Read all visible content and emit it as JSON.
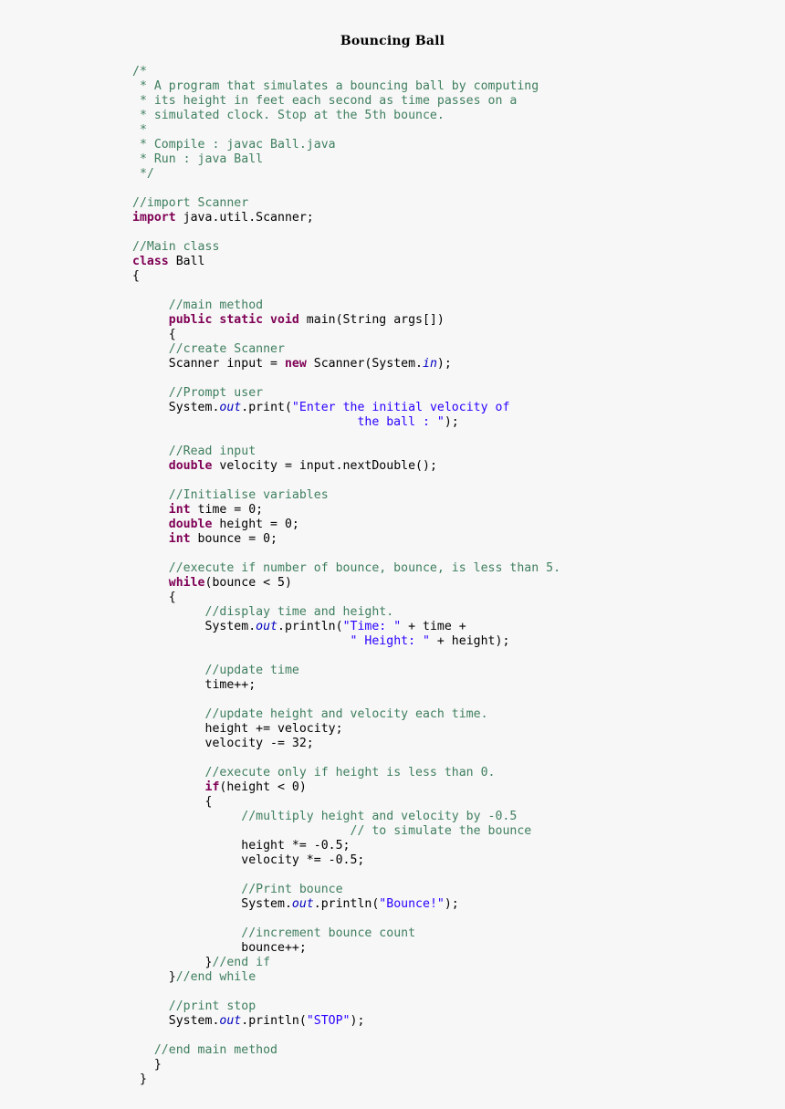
{
  "document": {
    "title": "Bouncing Ball",
    "language": "java",
    "colors": {
      "background": "#f7f7f7",
      "plain": "#000000",
      "comment": "#3f7f5f",
      "keyword": "#7f0055",
      "string": "#2a00ff",
      "static_field": "#0000c0"
    }
  },
  "code": {
    "lines": [
      [
        {
          "t": "/*",
          "c": "cmt"
        }
      ],
      [
        {
          "t": " * A program that simulates a bouncing ball by computing",
          "c": "cmt"
        }
      ],
      [
        {
          "t": " * its height in feet each second as time passes on a",
          "c": "cmt"
        }
      ],
      [
        {
          "t": " * simulated clock. Stop at the 5th bounce.",
          "c": "cmt"
        }
      ],
      [
        {
          "t": " *",
          "c": "cmt"
        }
      ],
      [
        {
          "t": " * Compile : javac Ball.java",
          "c": "cmt"
        }
      ],
      [
        {
          "t": " * Run : java Ball",
          "c": "cmt"
        }
      ],
      [
        {
          "t": " */",
          "c": "cmt"
        }
      ],
      [],
      [
        {
          "t": "//import Scanner",
          "c": "cmt"
        }
      ],
      [
        {
          "t": "import",
          "c": "kw"
        },
        {
          "t": " java.util.Scanner;",
          "c": "pln"
        }
      ],
      [],
      [
        {
          "t": "//Main class",
          "c": "cmt"
        }
      ],
      [
        {
          "t": "class",
          "c": "kw"
        },
        {
          "t": " Ball",
          "c": "pln"
        }
      ],
      [
        {
          "t": "{",
          "c": "pln"
        }
      ],
      [],
      [
        {
          "t": "     ",
          "c": "pln"
        },
        {
          "t": "//main method",
          "c": "cmt"
        }
      ],
      [
        {
          "t": "     ",
          "c": "pln"
        },
        {
          "t": "public static void",
          "c": "kw"
        },
        {
          "t": " main(String args[])",
          "c": "pln"
        }
      ],
      [
        {
          "t": "     {",
          "c": "pln"
        }
      ],
      [
        {
          "t": "     ",
          "c": "pln"
        },
        {
          "t": "//create Scanner",
          "c": "cmt"
        }
      ],
      [
        {
          "t": "     Scanner input = ",
          "c": "pln"
        },
        {
          "t": "new",
          "c": "kw"
        },
        {
          "t": " Scanner(System.",
          "c": "pln"
        },
        {
          "t": "in",
          "c": "fld"
        },
        {
          "t": ");",
          "c": "pln"
        }
      ],
      [],
      [
        {
          "t": "     ",
          "c": "pln"
        },
        {
          "t": "//Prompt user",
          "c": "cmt"
        }
      ],
      [
        {
          "t": "     System.",
          "c": "pln"
        },
        {
          "t": "out",
          "c": "fld"
        },
        {
          "t": ".print(",
          "c": "pln"
        },
        {
          "t": "\"Enter the initial velocity of",
          "c": "str"
        }
      ],
      [
        {
          "t": "                               ",
          "c": "pln"
        },
        {
          "t": "the ball : \"",
          "c": "str"
        },
        {
          "t": ");",
          "c": "pln"
        }
      ],
      [],
      [
        {
          "t": "     ",
          "c": "pln"
        },
        {
          "t": "//Read input",
          "c": "cmt"
        }
      ],
      [
        {
          "t": "     ",
          "c": "pln"
        },
        {
          "t": "double",
          "c": "kw"
        },
        {
          "t": " velocity = input.nextDouble();",
          "c": "pln"
        }
      ],
      [],
      [
        {
          "t": "     ",
          "c": "pln"
        },
        {
          "t": "//Initialise variables",
          "c": "cmt"
        }
      ],
      [
        {
          "t": "     ",
          "c": "pln"
        },
        {
          "t": "int",
          "c": "kw"
        },
        {
          "t": " time = 0;",
          "c": "pln"
        }
      ],
      [
        {
          "t": "     ",
          "c": "pln"
        },
        {
          "t": "double",
          "c": "kw"
        },
        {
          "t": " height = 0;",
          "c": "pln"
        }
      ],
      [
        {
          "t": "     ",
          "c": "pln"
        },
        {
          "t": "int",
          "c": "kw"
        },
        {
          "t": " bounce = 0;",
          "c": "pln"
        }
      ],
      [],
      [
        {
          "t": "     ",
          "c": "pln"
        },
        {
          "t": "//execute if number of bounce, bounce, is less than 5.",
          "c": "cmt"
        }
      ],
      [
        {
          "t": "     ",
          "c": "pln"
        },
        {
          "t": "while",
          "c": "kw"
        },
        {
          "t": "(bounce < 5)",
          "c": "pln"
        }
      ],
      [
        {
          "t": "     {",
          "c": "pln"
        }
      ],
      [
        {
          "t": "          ",
          "c": "pln"
        },
        {
          "t": "//display time and height.",
          "c": "cmt"
        }
      ],
      [
        {
          "t": "          System.",
          "c": "pln"
        },
        {
          "t": "out",
          "c": "fld"
        },
        {
          "t": ".println(",
          "c": "pln"
        },
        {
          "t": "\"Time: \"",
          "c": "str"
        },
        {
          "t": " + time +",
          "c": "pln"
        }
      ],
      [
        {
          "t": "                              ",
          "c": "pln"
        },
        {
          "t": "\" Height: \"",
          "c": "str"
        },
        {
          "t": " + height);",
          "c": "pln"
        }
      ],
      [],
      [
        {
          "t": "          ",
          "c": "pln"
        },
        {
          "t": "//update time",
          "c": "cmt"
        }
      ],
      [
        {
          "t": "          time++;",
          "c": "pln"
        }
      ],
      [],
      [
        {
          "t": "          ",
          "c": "pln"
        },
        {
          "t": "//update height and velocity each time.",
          "c": "cmt"
        }
      ],
      [
        {
          "t": "          height += velocity;",
          "c": "pln"
        }
      ],
      [
        {
          "t": "          velocity -= 32;",
          "c": "pln"
        }
      ],
      [],
      [
        {
          "t": "          ",
          "c": "pln"
        },
        {
          "t": "//execute only if height is less than 0.",
          "c": "cmt"
        }
      ],
      [
        {
          "t": "          ",
          "c": "pln"
        },
        {
          "t": "if",
          "c": "kw"
        },
        {
          "t": "(height < 0)",
          "c": "pln"
        }
      ],
      [
        {
          "t": "          {",
          "c": "pln"
        }
      ],
      [
        {
          "t": "               ",
          "c": "pln"
        },
        {
          "t": "//multiply height and velocity by -0.5",
          "c": "cmt"
        }
      ],
      [
        {
          "t": "                              ",
          "c": "pln"
        },
        {
          "t": "// to simulate the bounce",
          "c": "cmt"
        }
      ],
      [
        {
          "t": "               height *= -0.5;",
          "c": "pln"
        }
      ],
      [
        {
          "t": "               velocity *= -0.5;",
          "c": "pln"
        }
      ],
      [],
      [
        {
          "t": "               ",
          "c": "pln"
        },
        {
          "t": "//Print bounce",
          "c": "cmt"
        }
      ],
      [
        {
          "t": "               System.",
          "c": "pln"
        },
        {
          "t": "out",
          "c": "fld"
        },
        {
          "t": ".println(",
          "c": "pln"
        },
        {
          "t": "\"Bounce!\"",
          "c": "str"
        },
        {
          "t": ");",
          "c": "pln"
        }
      ],
      [],
      [
        {
          "t": "               ",
          "c": "pln"
        },
        {
          "t": "//increment bounce count",
          "c": "cmt"
        }
      ],
      [
        {
          "t": "               bounce++;",
          "c": "pln"
        }
      ],
      [
        {
          "t": "          }",
          "c": "pln"
        },
        {
          "t": "//end if",
          "c": "cmt"
        }
      ],
      [
        {
          "t": "     }",
          "c": "pln"
        },
        {
          "t": "//end while",
          "c": "cmt"
        }
      ],
      [],
      [
        {
          "t": "     ",
          "c": "pln"
        },
        {
          "t": "//print stop",
          "c": "cmt"
        }
      ],
      [
        {
          "t": "     System.",
          "c": "pln"
        },
        {
          "t": "out",
          "c": "fld"
        },
        {
          "t": ".println(",
          "c": "pln"
        },
        {
          "t": "\"STOP\"",
          "c": "str"
        },
        {
          "t": ");",
          "c": "pln"
        }
      ],
      [],
      [
        {
          "t": "   ",
          "c": "pln"
        },
        {
          "t": "//end main method",
          "c": "cmt"
        }
      ],
      [
        {
          "t": "   }",
          "c": "pln"
        }
      ],
      [
        {
          "t": " }",
          "c": "pln"
        }
      ]
    ]
  }
}
